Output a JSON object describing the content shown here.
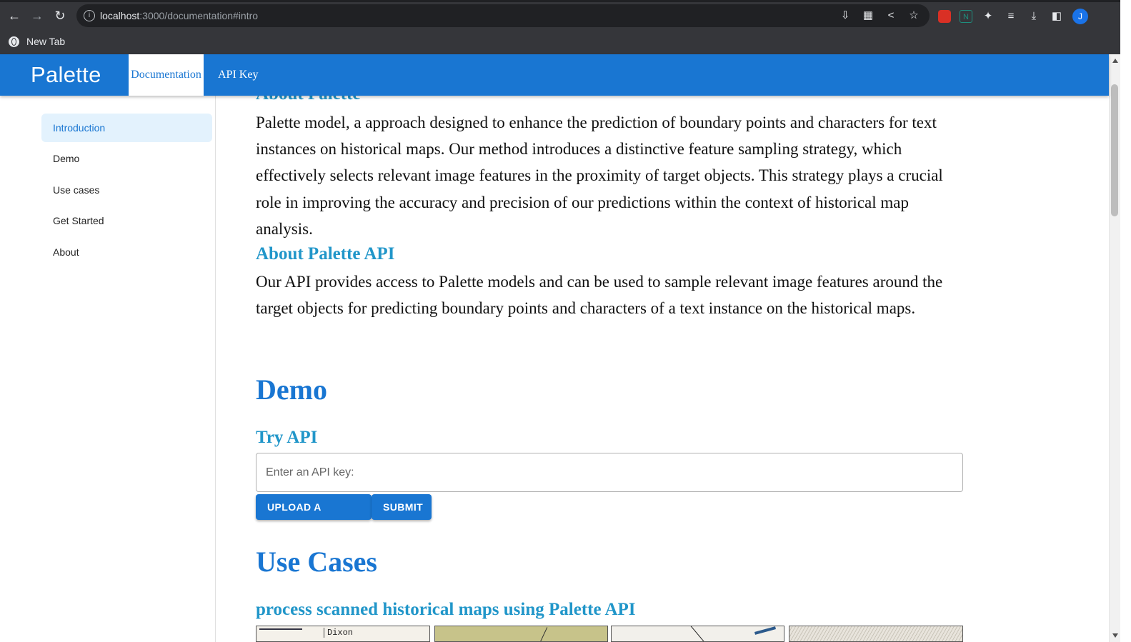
{
  "browser": {
    "url_host": "localhost",
    "url_path": ":3000/documentation#intro",
    "bookmark_label": "New Tab",
    "avatar_letter": "J"
  },
  "app": {
    "brand": "Palette",
    "tabs": [
      {
        "label": "Documentation",
        "active": true
      },
      {
        "label": "API Key",
        "active": false
      }
    ],
    "accent_color": "#1976d2"
  },
  "sidebar": {
    "items": [
      {
        "label": "Introduction",
        "active": true
      },
      {
        "label": "Demo"
      },
      {
        "label": "Use cases"
      },
      {
        "label": "Get Started"
      },
      {
        "label": "About"
      }
    ]
  },
  "content": {
    "about_palette_heading": "About Palette",
    "about_palette_text": "Palette model, a approach designed to enhance the prediction of boundary points and characters for text instances on historical maps. Our method introduces a distinctive feature sampling strategy, which effectively selects relevant image features in the proximity of target objects. This strategy plays a crucial role in improving the accuracy and precision of our predictions within the context of historical map analysis.",
    "about_api_heading": "About Palette API",
    "about_api_text": "Our API provides access to Palette models and can be used to sample relevant image features around the target objects for predicting boundary points and characters of a text instance on the historical maps.",
    "demo_heading": "Demo",
    "try_api_heading": "Try API",
    "api_key_placeholder": "Enter an API key:",
    "upload_label": "UPLOAD A PICTURE",
    "submit_label": "SUBMIT",
    "use_cases_heading": "Use Cases",
    "use_case_sub": "process scanned historical maps using Palette API",
    "map_label": "Dixon"
  }
}
